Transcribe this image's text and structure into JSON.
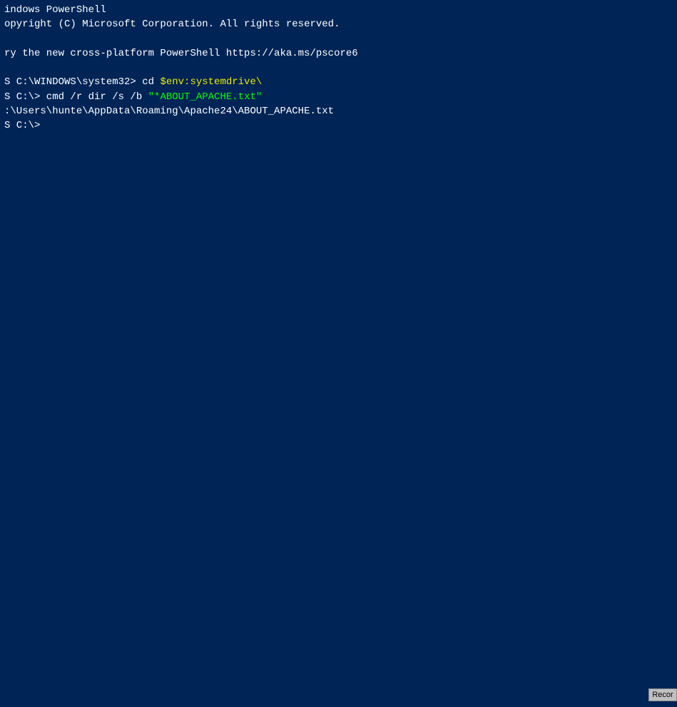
{
  "terminal": {
    "title": "Windows PowerShell",
    "lines": [
      {
        "id": "line1",
        "segments": [
          {
            "text": "indows PowerShell",
            "color": "white"
          }
        ]
      },
      {
        "id": "line2",
        "segments": [
          {
            "text": "opyright (C) Microsoft Corporation. All rights reserved.",
            "color": "white"
          }
        ]
      },
      {
        "id": "line3",
        "segments": []
      },
      {
        "id": "line4",
        "segments": [
          {
            "text": "ry the new cross-platform PowerShell https://aka.ms/pscore6",
            "color": "white"
          }
        ]
      },
      {
        "id": "line5",
        "segments": []
      },
      {
        "id": "line6",
        "segments": [
          {
            "text": "S C:\\WINDOWS\\system32> cd ",
            "color": "white"
          },
          {
            "text": "$env:systemdrive\\",
            "color": "yellow"
          }
        ]
      },
      {
        "id": "line7",
        "segments": [
          {
            "text": "S C:\\> cmd /r dir /s /b ",
            "color": "white"
          },
          {
            "text": "\"*ABOUT_APACHE.txt\"",
            "color": "green"
          }
        ]
      },
      {
        "id": "line8",
        "segments": [
          {
            "text": ":\\Users\\hunte\\AppData\\Roaming\\Apache24\\ABOUT_APACHE.txt",
            "color": "white"
          }
        ]
      },
      {
        "id": "line9",
        "segments": [
          {
            "text": "S C:\\>",
            "color": "white"
          }
        ]
      }
    ]
  },
  "record_button": {
    "label": "Recor"
  }
}
